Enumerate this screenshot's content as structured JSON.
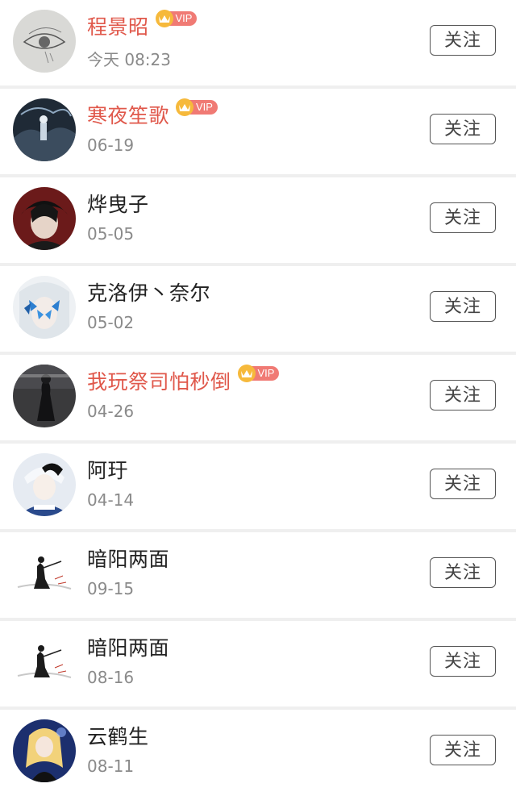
{
  "follow_list": [
    {
      "name": "程景昭",
      "vip": true,
      "vip_label": "VIP",
      "time": "今天 08:23",
      "follow_label": "关注",
      "avatar": "sketch-eye"
    },
    {
      "name": "寒夜笙歌",
      "vip": true,
      "vip_label": "VIP",
      "time": "06-19",
      "follow_label": "关注",
      "avatar": "dark-landscape"
    },
    {
      "name": "烨曳子",
      "vip": false,
      "time": "05-05",
      "follow_label": "关注",
      "avatar": "dark-hair-boy"
    },
    {
      "name": "克洛伊丶奈尔",
      "vip": false,
      "time": "05-02",
      "follow_label": "关注",
      "avatar": "blue-butterflies"
    },
    {
      "name": "我玩祭司怕秒倒",
      "vip": true,
      "vip_label": "VIP",
      "time": "04-26",
      "follow_label": "关注",
      "avatar": "dark-figure"
    },
    {
      "name": "阿玗",
      "vip": false,
      "time": "04-14",
      "follow_label": "关注",
      "avatar": "white-hair-boy"
    },
    {
      "name": "暗阳两面",
      "vip": false,
      "time": "09-15",
      "follow_label": "关注",
      "avatar": "swordsman-silhouette"
    },
    {
      "name": "暗阳两面",
      "vip": false,
      "time": "08-16",
      "follow_label": "关注",
      "avatar": "swordsman-silhouette"
    },
    {
      "name": "云鹤生",
      "vip": false,
      "time": "08-11",
      "follow_label": "关注",
      "avatar": "anime-girl"
    }
  ],
  "colors": {
    "vip_name": "#e0584b",
    "normal_name": "#222222",
    "time": "#8a8a8a",
    "badge": "#f07a74",
    "crown": "#f6b93b"
  }
}
